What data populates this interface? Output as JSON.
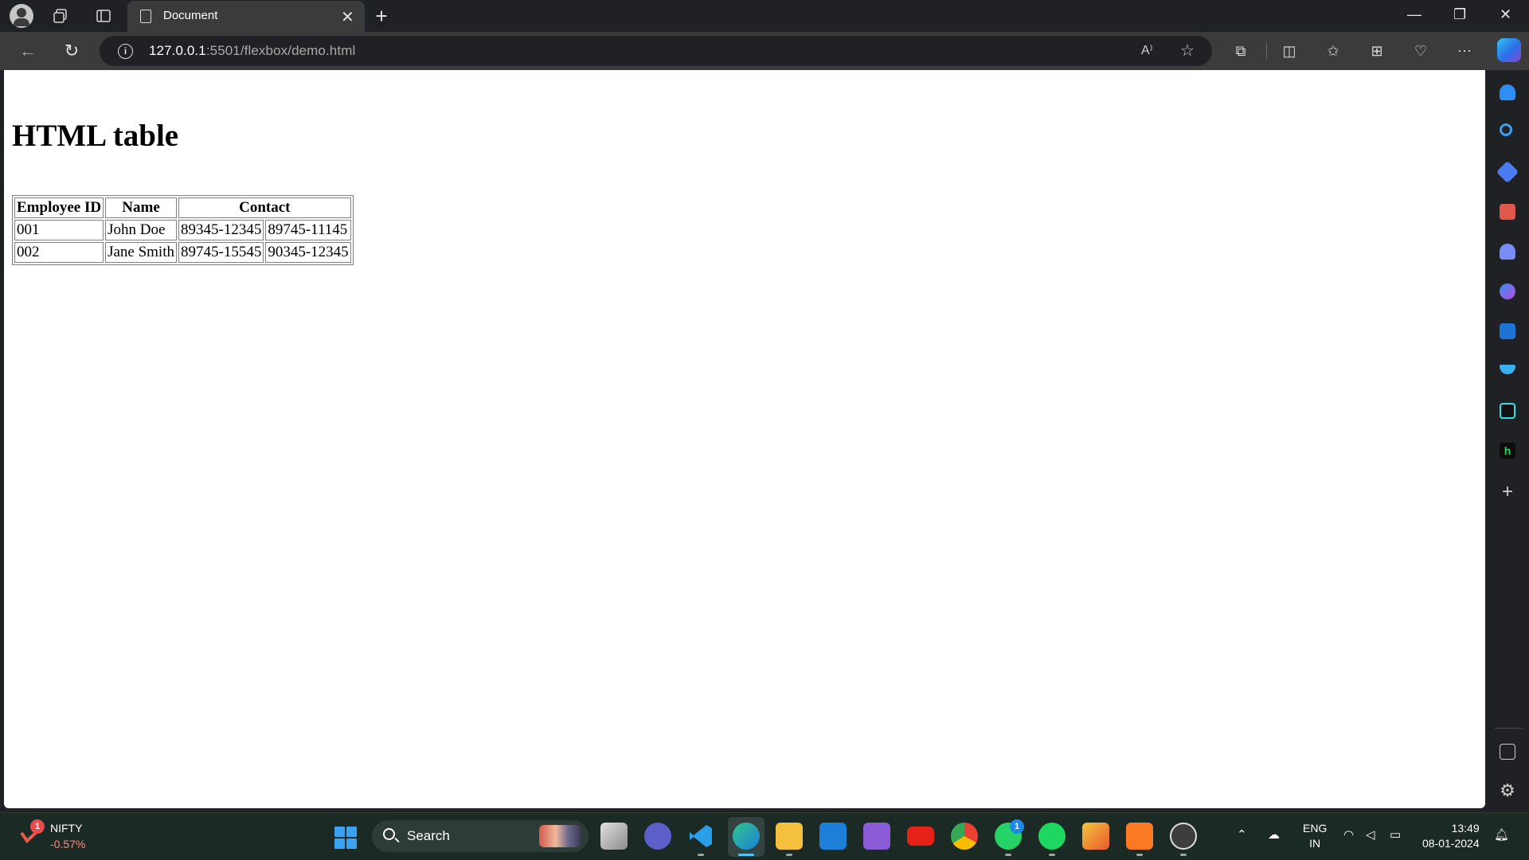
{
  "browser": {
    "tab_title": "Document",
    "url_host": "127.0.0.1",
    "url_rest": ":5501/flexbox/demo.html"
  },
  "page": {
    "heading": "HTML table",
    "table": {
      "headers": [
        "Employee ID",
        "Name",
        "Contact"
      ],
      "rows": [
        [
          "001",
          "John Doe",
          "89345-12345",
          "89745-11145"
        ],
        [
          "002",
          "Jane Smith",
          "89745-15545",
          "90345-12345"
        ]
      ]
    }
  },
  "taskbar": {
    "ticker_name": "NIFTY",
    "ticker_change": "-0.57%",
    "ticker_badge": "1",
    "search_label": "Search",
    "whatsapp_badge": "1",
    "lang_line1": "ENG",
    "lang_line2": "IN",
    "time": "13:49",
    "date": "08-01-2024"
  },
  "colors": {
    "accent": "#4fc3f7",
    "brand_edge": "#2a6fe8"
  },
  "icons": {
    "titlebar": [
      "profile-icon",
      "workspaces-icon",
      "tab-actions-icon"
    ],
    "toolbar": [
      "read-aloud-icon",
      "favorite-star-icon",
      "extensions-icon",
      "split-screen-icon",
      "favorites-icon",
      "collections-icon",
      "browser-essentials-icon",
      "more-icon",
      "copilot-icon"
    ],
    "sidebar": [
      "notifications-icon",
      "search-icon",
      "shopping-icon",
      "tools-icon",
      "games-icon",
      "microsoft-365-icon",
      "outlook-icon",
      "drop-icon",
      "tiktok-icon",
      "h-app-icon",
      "add-icon",
      "hide-sidebar-icon",
      "settings-icon"
    ]
  }
}
